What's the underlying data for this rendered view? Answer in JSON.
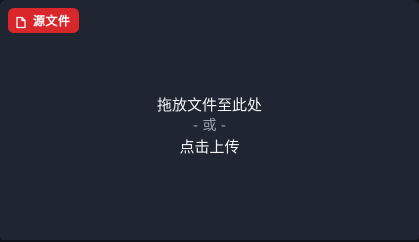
{
  "badge": {
    "label": "源文件",
    "icon": "file-icon",
    "color": "#d9262b"
  },
  "dropzone": {
    "drag_text": "拖放文件至此处",
    "or_text": "- 或 -",
    "upload_text": "点击上传"
  },
  "colors": {
    "panel_background": "#1f2632",
    "text_primary": "#f2f4f7",
    "text_secondary": "#9aa3ad"
  }
}
